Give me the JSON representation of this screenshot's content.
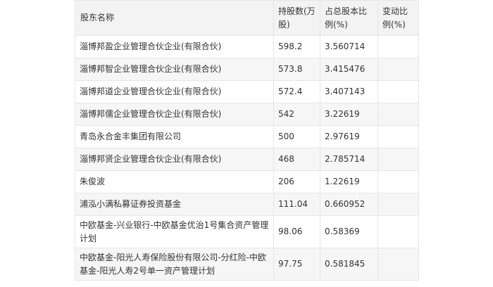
{
  "table": {
    "headers": {
      "name": "股东名称",
      "shares": "持股数(万股)",
      "ratio": "占总股本比例(%)",
      "change": "变动比例(%)"
    },
    "rows": [
      {
        "name": "淄博邦盈企业管理合伙企业(有限合伙)",
        "shares": "598.2",
        "ratio": "3.560714",
        "change": ""
      },
      {
        "name": "淄博邦智企业管理合伙企业(有限合伙)",
        "shares": "573.8",
        "ratio": "3.415476",
        "change": ""
      },
      {
        "name": "淄博邦道企业管理合伙企业(有限合伙)",
        "shares": "572.4",
        "ratio": "3.407143",
        "change": ""
      },
      {
        "name": "淄博邦儒企业管理合伙企业(有限合伙)",
        "shares": "542",
        "ratio": "3.22619",
        "change": ""
      },
      {
        "name": "青岛永合金丰集团有限公司",
        "shares": "500",
        "ratio": "2.97619",
        "change": ""
      },
      {
        "name": "淄博邦贤企业管理合伙企业(有限合伙)",
        "shares": "468",
        "ratio": "2.785714",
        "change": ""
      },
      {
        "name": "朱俊波",
        "shares": "206",
        "ratio": "1.22619",
        "change": ""
      },
      {
        "name": "浦泓小满私募证券投资基金",
        "shares": "111.04",
        "ratio": "0.660952",
        "change": ""
      },
      {
        "name": "中欧基金-兴业银行-中欧基金优治1号集合资产管理计划",
        "shares": "98.06",
        "ratio": "0.58369",
        "change": ""
      },
      {
        "name": "中欧基金-阳光人寿保险股份有限公司-分红险-中欧基金-阳光人寿2号单一资产管理计划",
        "shares": "97.75",
        "ratio": "0.581845",
        "change": ""
      }
    ]
  }
}
